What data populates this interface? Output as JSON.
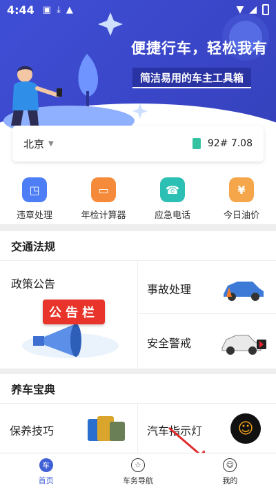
{
  "status_bar": {
    "time": "4:44"
  },
  "banner": {
    "headline": "便捷行车，轻松我有",
    "subline": "简洁易用的车主工具箱"
  },
  "location_card": {
    "city": "北京",
    "fuel_price": "92# 7.08"
  },
  "quick_actions": [
    {
      "label": "违章处理",
      "icon": "violation-icon",
      "color": "#4d7ef5"
    },
    {
      "label": "年检计算器",
      "icon": "inspection-car-icon",
      "color": "#f58b3a"
    },
    {
      "label": "应急电话",
      "icon": "phone-icon",
      "color": "#2cbfb3"
    },
    {
      "label": "今日油价",
      "icon": "fuel-price-icon",
      "color": "#f5a54a"
    }
  ],
  "traffic_section": {
    "title": "交通法规",
    "items": [
      {
        "label": "政策公告",
        "badge": "公告栏"
      },
      {
        "label": "事故处理"
      },
      {
        "label": "安全警戒"
      }
    ]
  },
  "care_section": {
    "title": "养车宝典",
    "items": [
      {
        "label": "保养技巧"
      },
      {
        "label": "汽车指示灯"
      }
    ]
  },
  "bottom_nav": [
    {
      "label": "首页",
      "active": true
    },
    {
      "label": "车务导航",
      "active": false
    },
    {
      "label": "我的",
      "active": false
    }
  ],
  "colors": {
    "brand": "#3f4fd6",
    "accent_red": "#e8342a"
  }
}
